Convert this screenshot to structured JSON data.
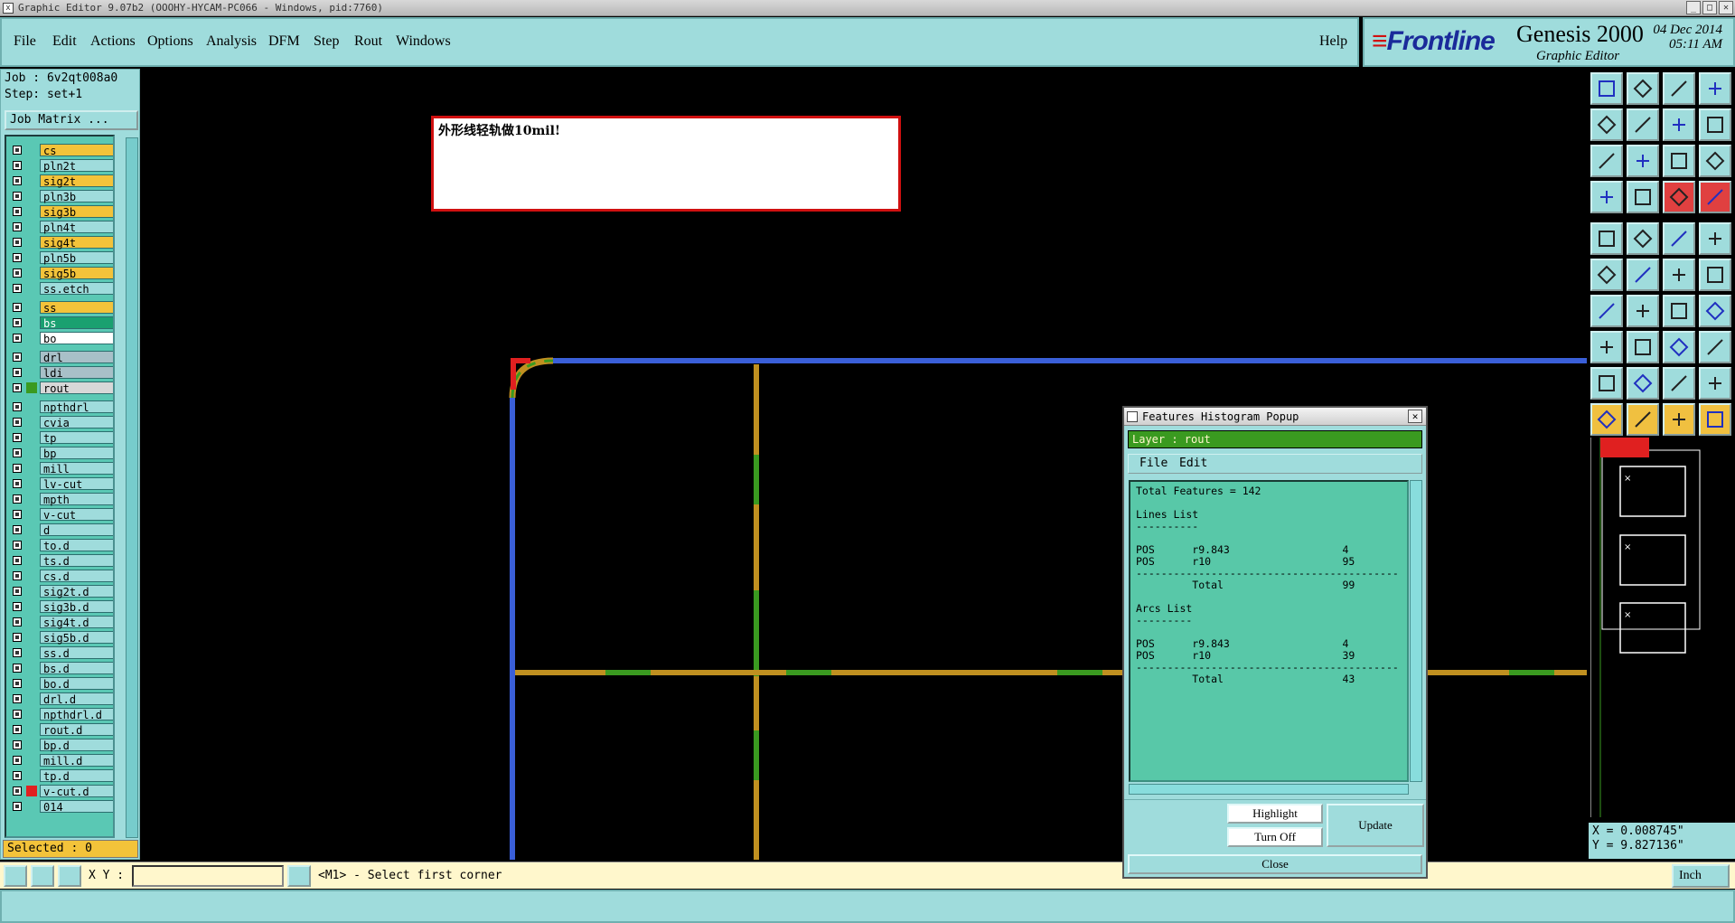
{
  "titlebar": {
    "title": "Graphic Editor 9.07b2 (OOOHY-HYCAM-PC066 - Windows, pid:7760)"
  },
  "menu": {
    "items": [
      "File",
      "Edit",
      "Actions",
      "Options",
      "Analysis",
      "DFM",
      "Step",
      "Rout",
      "Windows"
    ],
    "help": "Help"
  },
  "brand": {
    "logo": "Frontline",
    "product": "Genesis 2000",
    "subtitle": "Graphic Editor",
    "date": "04 Dec 2014",
    "time": "05:11 AM"
  },
  "left": {
    "job": "Job : 6v2qt008a0",
    "step": "Step: set+1",
    "job_matrix": "Job Matrix ...",
    "selected": "Selected : 0",
    "layers": [
      {
        "name": "cs",
        "color": "#f3c33a"
      },
      {
        "name": "pln2t",
        "color": "#9fdcdc"
      },
      {
        "name": "sig2t",
        "color": "#f3c33a"
      },
      {
        "name": "pln3b",
        "color": "#9fdcdc"
      },
      {
        "name": "sig3b",
        "color": "#f3c33a"
      },
      {
        "name": "pln4t",
        "color": "#9fdcdc"
      },
      {
        "name": "sig4t",
        "color": "#f3c33a"
      },
      {
        "name": "pln5b",
        "color": "#9fdcdc"
      },
      {
        "name": "sig5b",
        "color": "#f3c33a"
      },
      {
        "name": "ss.etch",
        "color": "#9fdcdc"
      },
      {
        "name": "ss",
        "color": "#f3c33a"
      },
      {
        "name": "bs",
        "color": "#1aa070"
      },
      {
        "name": "bo",
        "color": "#ffffff"
      },
      {
        "name": "drl",
        "color": "#a8c0c8"
      },
      {
        "name": "ldi",
        "color": "#a8c0c8"
      },
      {
        "name": "rout",
        "color": "#d8d8d8",
        "swatch": "#3a9a20"
      },
      {
        "name": "npthdrl",
        "color": "#9fdcdc"
      },
      {
        "name": "cvia",
        "color": "#9fdcdc"
      },
      {
        "name": "tp",
        "color": "#9fdcdc"
      },
      {
        "name": "bp",
        "color": "#9fdcdc"
      },
      {
        "name": "mill",
        "color": "#9fdcdc"
      },
      {
        "name": "lv-cut",
        "color": "#9fdcdc"
      },
      {
        "name": "mpth",
        "color": "#9fdcdc"
      },
      {
        "name": "v-cut",
        "color": "#9fdcdc"
      },
      {
        "name": "d",
        "color": "#9fdcdc"
      },
      {
        "name": "to.d",
        "color": "#9fdcdc"
      },
      {
        "name": "ts.d",
        "color": "#9fdcdc"
      },
      {
        "name": "cs.d",
        "color": "#9fdcdc"
      },
      {
        "name": "sig2t.d",
        "color": "#9fdcdc"
      },
      {
        "name": "sig3b.d",
        "color": "#9fdcdc"
      },
      {
        "name": "sig4t.d",
        "color": "#9fdcdc"
      },
      {
        "name": "sig5b.d",
        "color": "#9fdcdc"
      },
      {
        "name": "ss.d",
        "color": "#9fdcdc"
      },
      {
        "name": "bs.d",
        "color": "#9fdcdc"
      },
      {
        "name": "bo.d",
        "color": "#9fdcdc"
      },
      {
        "name": "drl.d",
        "color": "#9fdcdc"
      },
      {
        "name": "npthdrl.d",
        "color": "#9fdcdc"
      },
      {
        "name": "rout.d",
        "color": "#9fdcdc"
      },
      {
        "name": "bp.d",
        "color": "#9fdcdc"
      },
      {
        "name": "mill.d",
        "color": "#9fdcdc"
      },
      {
        "name": "tp.d",
        "color": "#9fdcdc"
      },
      {
        "name": "v-cut.d",
        "color": "#9fdcdc",
        "swatch": "#e02020"
      },
      {
        "name": "014",
        "color": "#9fdcdc"
      }
    ]
  },
  "canvas": {
    "message": "外形线轻轨做10mil!"
  },
  "coords": {
    "x": "X = 0.008745\"",
    "y": "Y = 9.827136\""
  },
  "status": {
    "xy_label": "X Y :",
    "message": "<M1> - Select first corner",
    "units": "Inch"
  },
  "popup": {
    "title": "Features Histogram Popup",
    "layer": "Layer :  rout",
    "menu": [
      "File",
      "Edit"
    ],
    "report": "Total Features = 142\n\nLines List\n----------\n\nPOS      r9.843                  4\nPOS      r10                     95\n------------------------------------------\n         Total                   99\n\nArcs List\n---------\n\nPOS      r9.843                  4\nPOS      r10                     39\n------------------------------------------\n         Total                   43",
    "highlight": "Highlight",
    "turn_off": "Turn Off",
    "update": "Update",
    "close": "Close"
  }
}
